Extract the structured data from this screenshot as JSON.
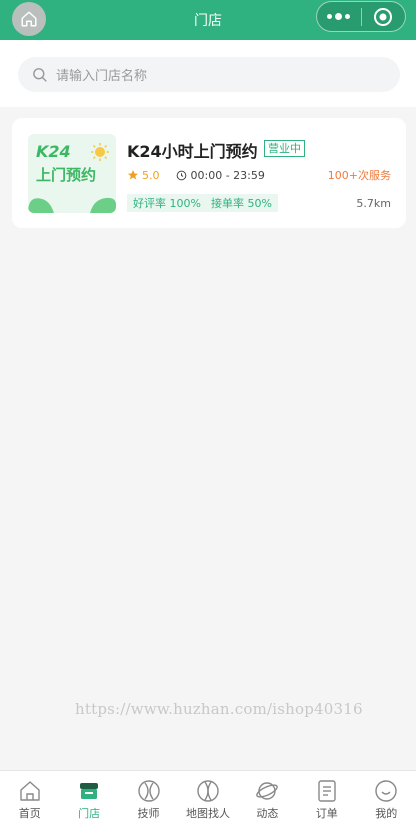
{
  "header": {
    "title": "门店"
  },
  "search": {
    "placeholder": "请输入门店名称"
  },
  "store": {
    "logo_brand": "K24",
    "logo_text": "上门预约",
    "name": "K24小时上门预约",
    "status": "营业中",
    "rating": "5.0",
    "hours": "00:00 - 23:59",
    "served": "100+次服务",
    "good_rate": "好评率 100%",
    "accept_rate": "接单率 50%",
    "distance": "5.7km"
  },
  "watermark": "https://www.huzhan.com/ishop40316",
  "tabbar": {
    "items": [
      {
        "label": "首页",
        "icon": "home-icon"
      },
      {
        "label": "门店",
        "icon": "store-icon"
      },
      {
        "label": "技师",
        "icon": "technician-icon"
      },
      {
        "label": "地图找人",
        "icon": "map-icon"
      },
      {
        "label": "动态",
        "icon": "planet-icon"
      },
      {
        "label": "订单",
        "icon": "order-icon"
      },
      {
        "label": "我的",
        "icon": "profile-icon"
      }
    ],
    "active_index": 1
  },
  "colors": {
    "primary": "#2fb27f",
    "accent_orange": "#f07a3a",
    "star": "#f0a020"
  }
}
